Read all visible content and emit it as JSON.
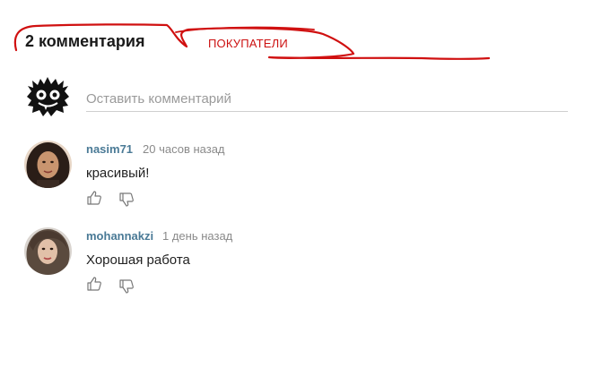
{
  "header": {
    "count_label": "2 комментария",
    "tab_label": "ПОКУПАТЕЛИ"
  },
  "compose": {
    "placeholder": "Оставить комментарий"
  },
  "comments": [
    {
      "author": "nasim71",
      "time": "20 часов назад",
      "text": "красивый!"
    },
    {
      "author": "mohannakzi",
      "time": "1 день назад",
      "text": "Хорошая работа"
    }
  ],
  "colors": {
    "author": "#4a7a96",
    "annotation": "#cc1111"
  },
  "icons": {
    "like": "thumb-up-icon",
    "dislike": "thumb-down-icon"
  }
}
